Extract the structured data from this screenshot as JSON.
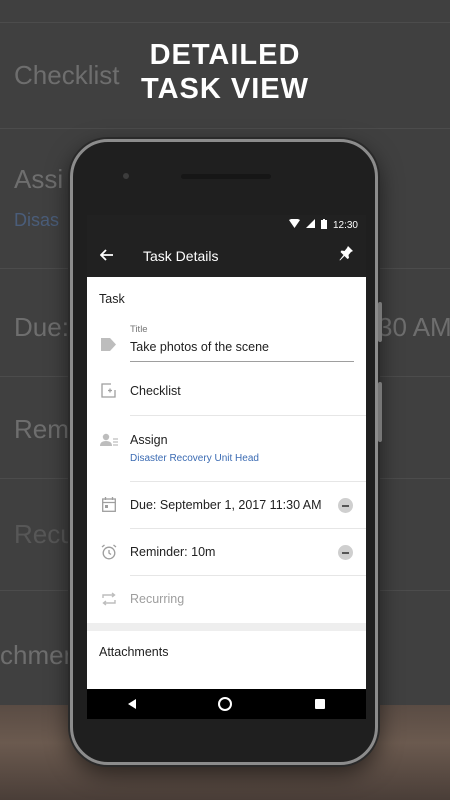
{
  "headline": {
    "line1": "DETAILED",
    "line2": "TASK VIEW"
  },
  "background": {
    "checklist": "Checklist",
    "assign": "Assi",
    "assign_sub": "Disas",
    "due": "Due:",
    "due_right": "30 AM",
    "reminder": "Rem",
    "recurring": "Recu",
    "attachments": "chmen"
  },
  "status_bar": {
    "time": "12:30"
  },
  "app_bar": {
    "title": "Task Details"
  },
  "task": {
    "section_label": "Task",
    "title_label": "Title",
    "title_value": "Take photos of the scene",
    "checklist_label": "Checklist",
    "assign_label": "Assign",
    "assign_value": "Disaster Recovery Unit Head",
    "due_label": "Due: September 1, 2017 11:30 AM",
    "reminder_label": "Reminder: 10m",
    "recurring_label": "Recurring",
    "attachments_label": "Attachments"
  },
  "icons": {
    "back": "arrow-left-icon",
    "pin": "pin-icon",
    "tag": "tag-icon",
    "checklist": "checklist-add-icon",
    "assign": "person-icon",
    "calendar": "calendar-icon",
    "alarm": "alarm-icon",
    "repeat": "repeat-icon"
  },
  "colors": {
    "app_bar": "#212121",
    "link": "#3b6bb3",
    "muted": "#9e9e9e"
  }
}
